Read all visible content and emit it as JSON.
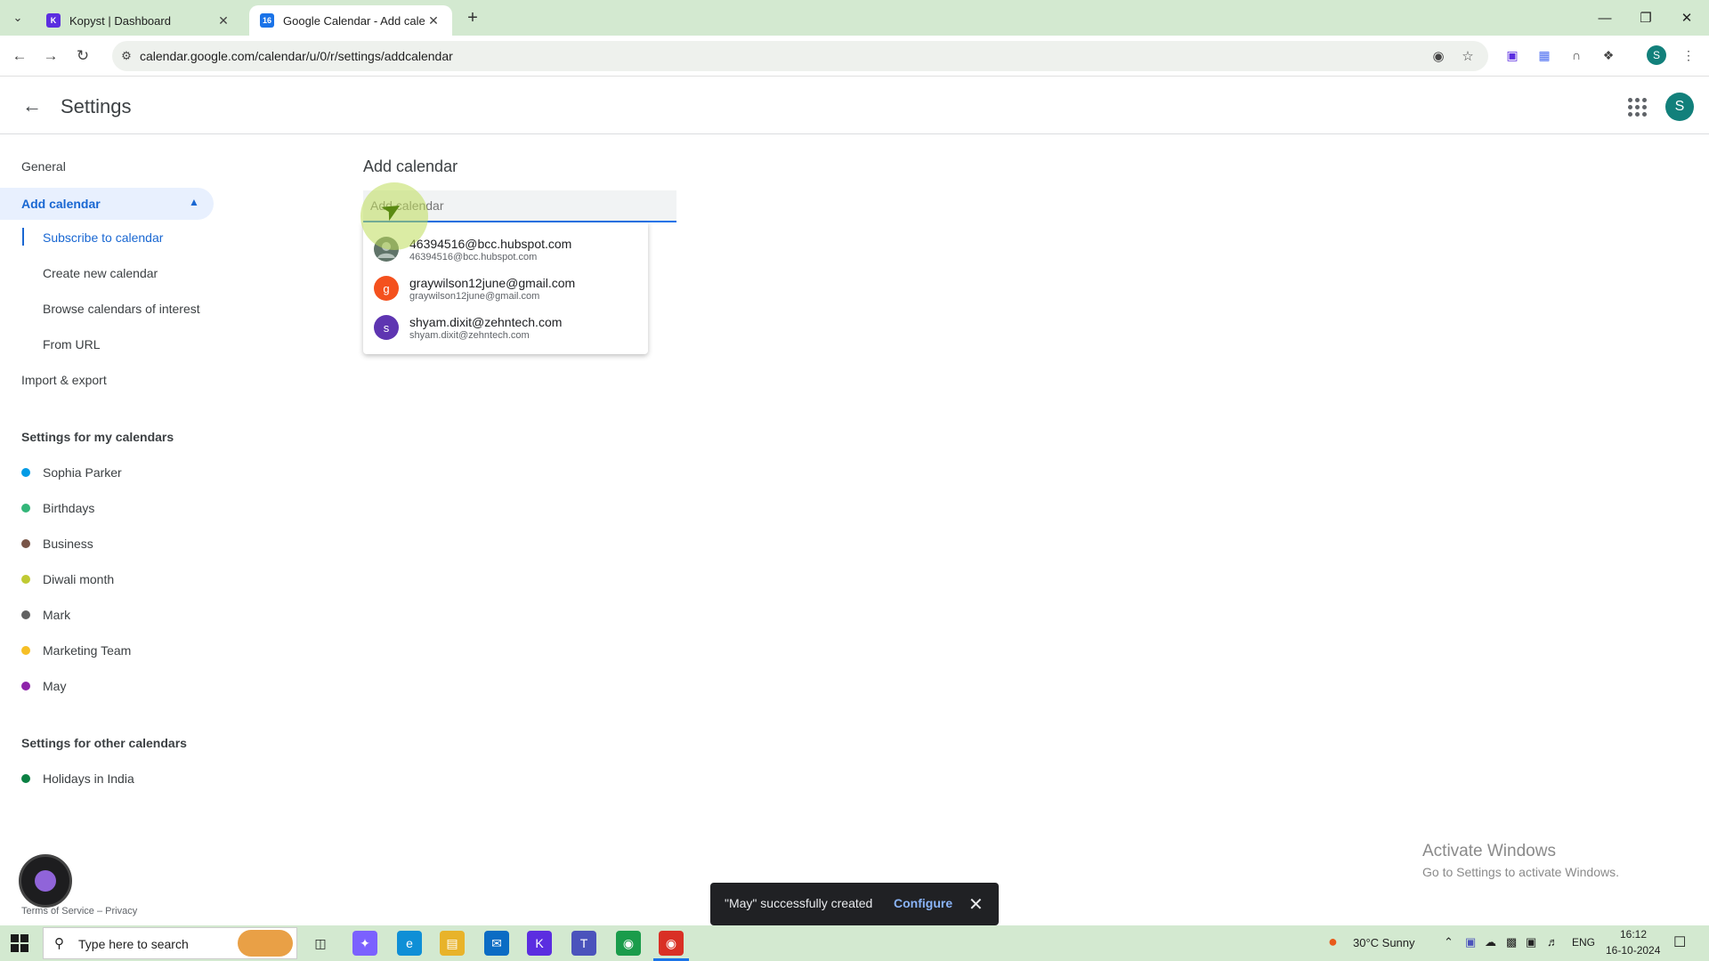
{
  "browser": {
    "tabs": [
      {
        "title": "Kopyst | Dashboard",
        "favicon_color": "#5b2ee0"
      },
      {
        "title": "Google Calendar - Add calenda",
        "favicon_color": "#1a73e8",
        "favicon_text": "16"
      }
    ],
    "url": "calendar.google.com/calendar/u/0/r/settings/addcalendar",
    "profile_initial": "S"
  },
  "header": {
    "title": "Settings",
    "avatar_initial": "S"
  },
  "sidebar": {
    "general": "General",
    "add_calendar": "Add calendar",
    "sub_items": [
      "Subscribe to calendar",
      "Create new calendar",
      "Browse calendars of interest",
      "From URL"
    ],
    "import_export": "Import & export",
    "my_calendars_heading": "Settings for my calendars",
    "my_calendars": [
      {
        "name": "Sophia Parker",
        "color": "#039be5"
      },
      {
        "name": "Birthdays",
        "color": "#33b679"
      },
      {
        "name": "Business",
        "color": "#795548"
      },
      {
        "name": "Diwali month",
        "color": "#c0ca33"
      },
      {
        "name": "Mark",
        "color": "#616161"
      },
      {
        "name": "Marketing Team",
        "color": "#f6bf26"
      },
      {
        "name": "May",
        "color": "#8e24aa"
      }
    ],
    "other_calendars_heading": "Settings for other calendars",
    "other_calendars": [
      {
        "name": "Holidays in India",
        "color": "#0b8043"
      }
    ]
  },
  "main": {
    "title": "Add calendar",
    "input_placeholder": "Add calendar",
    "suggestions": [
      {
        "email": "46394516@bcc.hubspot.com",
        "sub": "46394516@bcc.hubspot.com",
        "initial": "",
        "color": "#5f7368"
      },
      {
        "email": "graywilson12june@gmail.com",
        "sub": "graywilson12june@gmail.com",
        "initial": "g",
        "color": "#f4511e"
      },
      {
        "email": "shyam.dixit@zehntech.com",
        "sub": "shyam.dixit@zehntech.com",
        "initial": "s",
        "color": "#5e35b1"
      }
    ]
  },
  "footer": {
    "terms": "Terms of Service",
    "separator": "–",
    "privacy": "Privacy"
  },
  "toast": {
    "message": "\"May\" successfully created",
    "action": "Configure"
  },
  "watermark": {
    "line1": "Activate Windows",
    "line2": "Go to Settings to activate Windows."
  },
  "taskbar": {
    "search_placeholder": "Type here to search",
    "weather": "30°C  Sunny",
    "language": "ENG",
    "time": "16:12",
    "date": "16-10-2024"
  }
}
